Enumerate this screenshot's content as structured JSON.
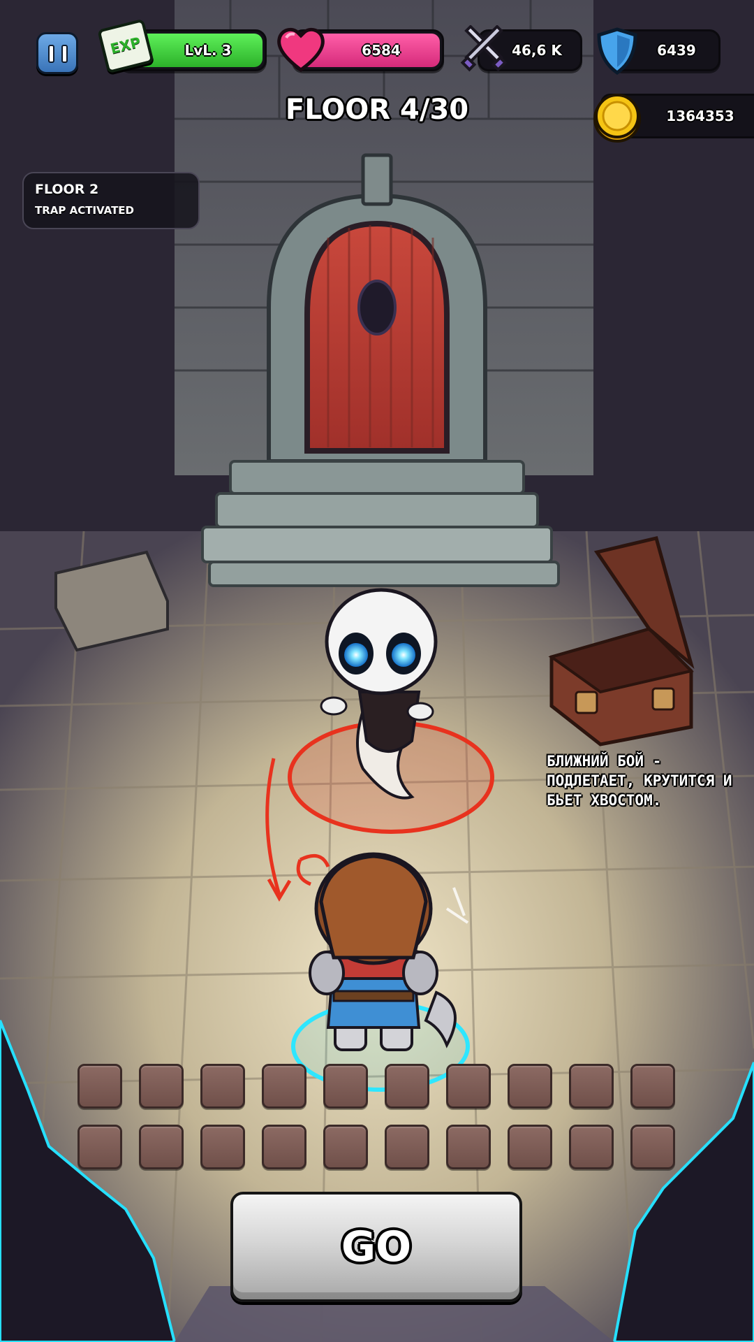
{
  "hud": {
    "exp_badge": "EXP",
    "level_label": "LvL. 3",
    "health_value": "6584",
    "attack_value": "46,6 K",
    "defense_value": "6439",
    "coins_value": "1364353"
  },
  "floor": {
    "title": "FLOOR 4/30"
  },
  "event_log": {
    "title": "FLOOR 2",
    "subtitle": "TRAP ACTIVATED"
  },
  "enemy_note": "Ближний бой - подлетает, крутится и бьет хвостом.",
  "inventory": {
    "rows": 2,
    "columns": 10,
    "filled_slots": 0
  },
  "actions": {
    "go_label": "GO"
  },
  "icons": {
    "pause": "pause-icon",
    "exp": "exp-scroll-icon",
    "health": "heart-icon",
    "attack": "crossed-swords-icon",
    "defense": "shield-icon",
    "coins": "gold-coin-icon"
  },
  "colors": {
    "exp_bar": "#3ccf3a",
    "health_bar": "#e83d8c",
    "coin": "#f5c414",
    "shield": "#47a4ec",
    "attack_ring": "#e8321e",
    "player_ring": "#2ee6ff"
  }
}
